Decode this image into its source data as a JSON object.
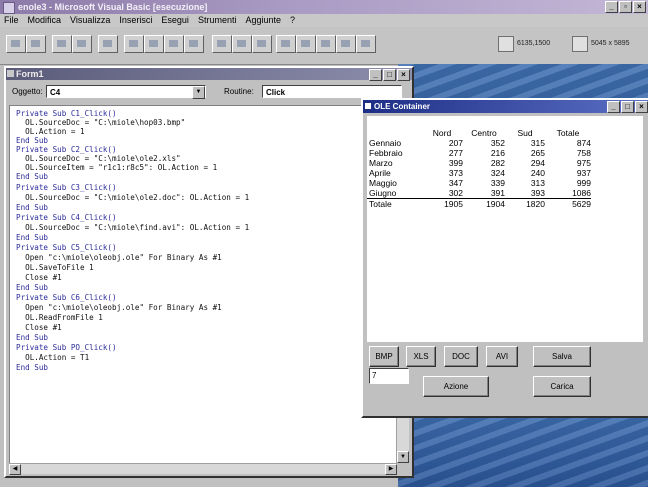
{
  "app": {
    "title": "enole3 - Microsoft Visual Basic [esecuzione]"
  },
  "menu": [
    "File",
    "Modifica",
    "Visualizza",
    "Inserisci",
    "Esegui",
    "Strumenti",
    "Aggiunte",
    "?"
  ],
  "toolbar": {
    "position_readout": "6135,1500",
    "size_readout": "5045 x 5895"
  },
  "code_window": {
    "title": "Form1",
    "object_label": "Oggetto:",
    "object_value": "C4",
    "routine_label": "Routine:",
    "routine_value": "Click",
    "lines": [
      "Private Sub C1_Click()",
      "  OL.SourceDoc = \"C:\\miole\\hop03.bmp\"",
      "  OL.Action = 1",
      "End Sub",
      "Private Sub C2_Click()",
      "  OL.SourceDoc = \"C:\\miole\\ole2.xls\"",
      "  OL.SourceItem = \"r1c1:r8c5\": OL.Action = 1",
      "End Sub",
      "Private Sub C3_Click()",
      "  OL.SourceDoc = \"C:\\miole\\ole2.doc\": OL.Action = 1",
      "End Sub",
      "Private Sub C4_Click()",
      "  OL.SourceDoc = \"C:\\miole\\find.avi\": OL.Action = 1",
      "End Sub",
      "Private Sub C5_Click()",
      "  Open \"c:\\miole\\oleobj.ole\" For Binary As #1",
      "  OL.SaveToFile 1",
      "  Close #1",
      "End Sub",
      "Private Sub C6_Click()",
      "  Open \"c:\\miole\\oleobj.ole\" For Binary As #1",
      "  OL.ReadFromFile 1",
      "  Close #1",
      "End Sub",
      "Private Sub PO_Click()",
      "  OL.Action = T1",
      "End Sub"
    ]
  },
  "ole_window": {
    "title": "OLE Container",
    "sheet": {
      "headers": [
        "",
        "Nord",
        "Centro",
        "Sud",
        "Totale"
      ],
      "rows": [
        [
          "Gennaio",
          "207",
          "352",
          "315",
          "874"
        ],
        [
          "Febbraio",
          "277",
          "216",
          "265",
          "758"
        ],
        [
          "Marzo",
          "399",
          "282",
          "294",
          "975"
        ],
        [
          "Aprile",
          "373",
          "324",
          "240",
          "937"
        ],
        [
          "Maggio",
          "347",
          "339",
          "313",
          "999"
        ],
        [
          "Giugno",
          "302",
          "391",
          "393",
          "1086"
        ],
        [
          "Totale",
          "1905",
          "1904",
          "1820",
          "5629"
        ]
      ]
    },
    "buttons": {
      "bmp": "BMP",
      "xls": "XLS",
      "doc": "DOC",
      "avi": "AVI",
      "salva": "Salva",
      "azione": "Azione",
      "carica": "Carica"
    },
    "action_input": "7"
  }
}
